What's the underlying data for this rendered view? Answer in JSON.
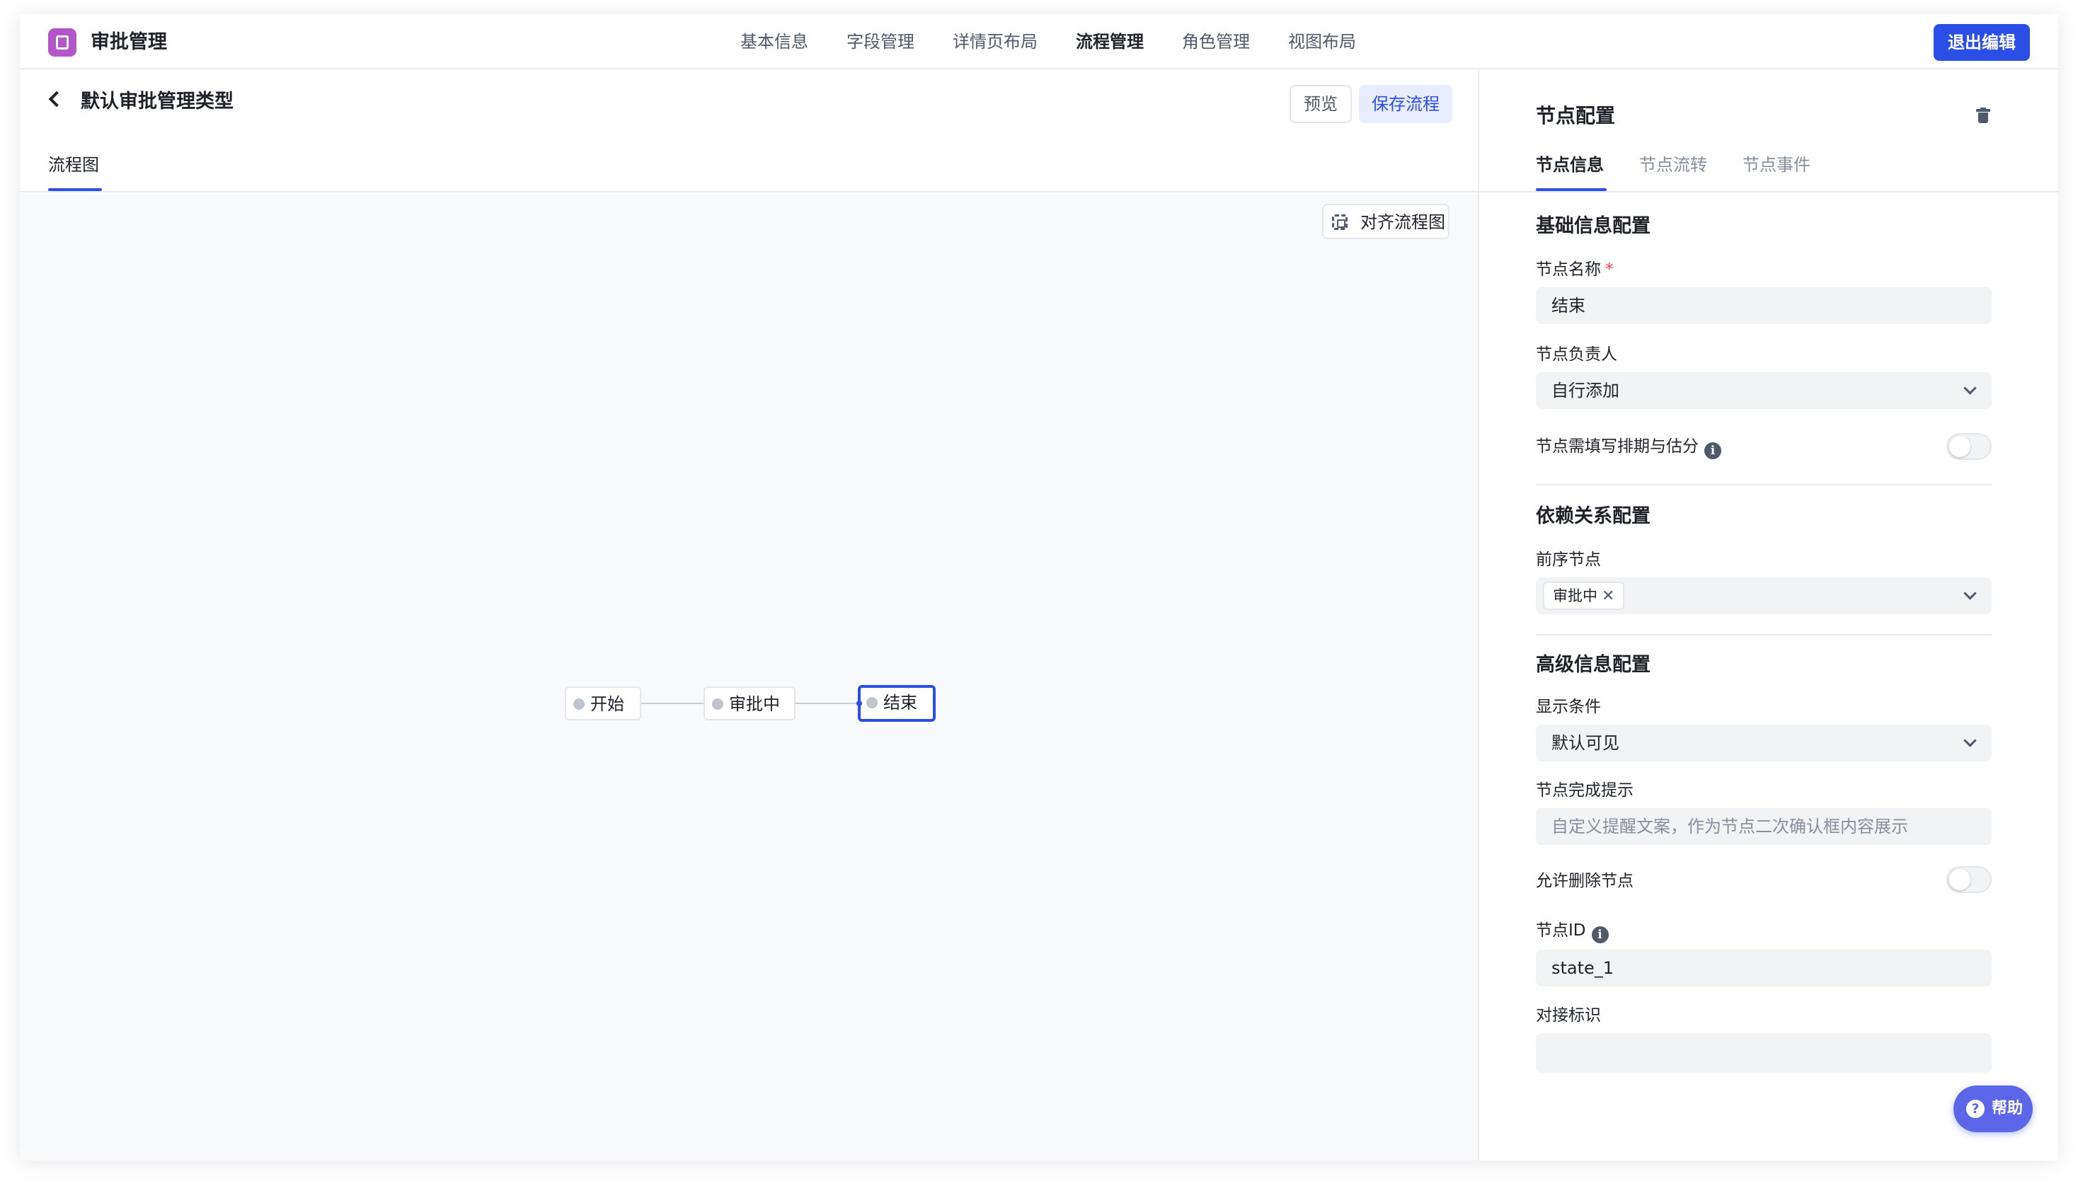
{
  "header": {
    "app_title": "审批管理",
    "nav": [
      "基本信息",
      "字段管理",
      "详情页布局",
      "流程管理",
      "角色管理",
      "视图布局"
    ],
    "active_nav": "流程管理",
    "exit_label": "退出编辑"
  },
  "editor": {
    "title": "默认审批管理类型",
    "preview_label": "预览",
    "save_label": "保存流程",
    "tab_label": "流程图",
    "align_label": "对齐流程图"
  },
  "flow": {
    "nodes": [
      {
        "label": "开始",
        "selected": false
      },
      {
        "label": "审批中",
        "selected": false
      },
      {
        "label": "结束",
        "selected": true
      }
    ]
  },
  "panel": {
    "title": "节点配置",
    "tabs": [
      "节点信息",
      "节点流转",
      "节点事件"
    ],
    "active_tab": "节点信息",
    "basic": {
      "section_title": "基础信息配置",
      "name_label": "节点名称",
      "required_mark": "*",
      "name_value": "结束",
      "owner_label": "节点负责人",
      "owner_value": "自行添加",
      "schedule_label": "节点需填写排期与估分",
      "schedule_enabled": false
    },
    "dependency": {
      "section_title": "依赖关系配置",
      "prev_label": "前序节点",
      "prev_tag": "审批中",
      "tag_close": "✕"
    },
    "advanced": {
      "section_title": "高级信息配置",
      "visible_label": "显示条件",
      "visible_value": "默认可见",
      "tip_label": "节点完成提示",
      "tip_placeholder": "自定义提醒文案，作为节点二次确认框内容展示",
      "delete_label": "允许删除节点",
      "delete_enabled": false,
      "id_label": "节点ID",
      "id_value": "state_1",
      "integration_label": "对接标识",
      "integration_value": ""
    }
  },
  "help": {
    "icon": "?",
    "label": "帮助"
  },
  "icons": {
    "info": "i"
  },
  "colors": {
    "primary": "#2b4ee6",
    "brand_logo": "#b455c9",
    "help": "#5b67e8",
    "required": "#f53f3f"
  }
}
